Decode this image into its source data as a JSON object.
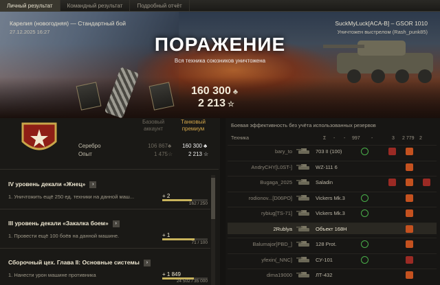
{
  "tabs": [
    "Личный результат",
    "Командный результат",
    "Подробный отчёт"
  ],
  "battle": {
    "map": "Карелия (новогодняя) — Стандартный бой",
    "date": "27.12.2025 16:27",
    "player": "SuckMyLuck[ACA-B] – GSOR 1010",
    "killed_by": "Уничтожен выстрелом (Rash_punk85)",
    "result": "ПОРАЖЕНИЕ",
    "reason": "Вся техника союзников уничтожена"
  },
  "totals": {
    "credits": "160 300",
    "xp": "2 213",
    "credits_icon": "♣",
    "xp_icon": "☆"
  },
  "earnings": {
    "col_base": "Базовый аккаунт",
    "col_premium": "Танковый премиум",
    "rows": [
      {
        "label": "Серебро",
        "base": "106 867",
        "premium": "160 300",
        "icon": "♣"
      },
      {
        "label": "Опыт",
        "base": "1 475",
        "premium": "2 213",
        "icon": "☆"
      }
    ]
  },
  "tasks": [
    {
      "title": "IV уровень декали «Жнец»",
      "text": "1. Уничтожить ещё 250 ед. техники на данной маш...",
      "gain": "+ 2",
      "progress": "162 / 250",
      "fraction": 0.648
    },
    {
      "title": "III уровень декали «Закалка боем»",
      "text": "1. Провести ещё 100 боёв на данной машине.",
      "gain": "+ 1",
      "progress": "71 / 100",
      "fraction": 0.71
    },
    {
      "title": "Сборочный цех. Глава II: Основные системы",
      "text": "1. Нанести урон машине противника",
      "gain": "+ 1 849",
      "progress": "24 502 / 35 000",
      "fraction": 0.7
    }
  ],
  "team": {
    "header": "Боевая эффективность без учёта использованных резервов",
    "col_vehicle": "Техника",
    "col_sum": "Σ",
    "col_a": "-",
    "col_b": "-",
    "col_c": "997",
    "col_d": "-",
    "col_e": "3",
    "col_f": "2 779",
    "col_g": "2",
    "rows": [
      {
        "player": "bary_to",
        "tank": "703 II (100)",
        "icons": [
          "green",
          "red",
          "orange"
        ],
        "me": false
      },
      {
        "player": "AndryCHY[L0ST-]",
        "tank": "WZ-111 6",
        "icons": [
          "",
          "",
          "orange"
        ],
        "me": false
      },
      {
        "player": "Bugaga_2025",
        "tank": "Saladin",
        "icons": [
          "",
          "red",
          "orange",
          "red"
        ],
        "me": false
      },
      {
        "player": "rodionov...[D06PO]",
        "tank": "Vickers Mk.3",
        "icons": [
          "green",
          "",
          "orange"
        ],
        "me": false
      },
      {
        "player": "rybiug[TS-71]",
        "tank": "Vickers Mk.3",
        "icons": [
          "green",
          "",
          "orange"
        ],
        "me": false
      },
      {
        "player": "2Rublya",
        "tank": "Объект 168Н",
        "icons": [
          "",
          "",
          "orange"
        ],
        "me": true
      },
      {
        "player": "Balumajor[PBD_]",
        "tank": "128 Prot.",
        "icons": [
          "green",
          "",
          "orange"
        ],
        "me": false
      },
      {
        "player": "yfexin(_NNC]",
        "tank": "СУ-101",
        "icons": [
          "green",
          "",
          "red"
        ],
        "me": false
      },
      {
        "player": "dima19000",
        "tank": "ЛТ-432",
        "icons": [
          "",
          "",
          "orange"
        ],
        "me": false
      }
    ]
  }
}
